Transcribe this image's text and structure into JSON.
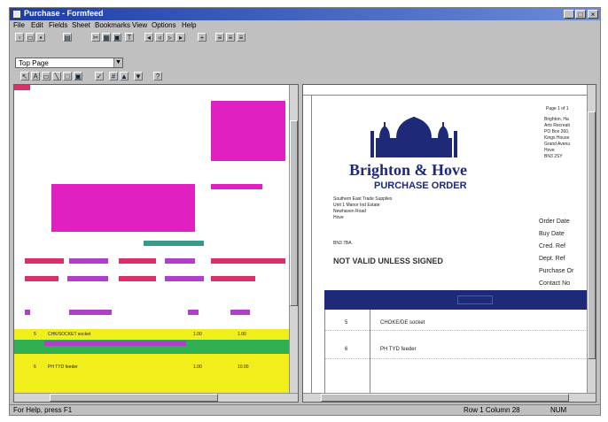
{
  "window": {
    "title": "Purchase - Formfeed"
  },
  "menu": [
    "File",
    "Edit",
    "Fields",
    "Sheet",
    "Bookmarks",
    "View",
    "Options",
    "Help"
  ],
  "style_combo": {
    "value": "Top Page"
  },
  "document": {
    "page_label": "Page 1 of 1",
    "brand": "Brighton & Hove",
    "doc_title": "PURCHASE ORDER",
    "supplier_lines": [
      "Southern East Trade Supplies",
      "Unit 1 Manor Ind Estate",
      "Newhaven Road",
      "Hove"
    ],
    "supplier_code": "BN3 7BA",
    "notice": "NOT VALID UNLESS SIGNED",
    "address_lines": [
      "Brighton, Ha",
      "Arts Recreati",
      "PO Box 260,",
      "Kings House",
      "Grand Avenu",
      "Hove",
      "BN3 2SY"
    ],
    "order_fields": [
      "Order Date",
      "Buy Date",
      "Cred. Ref",
      "Dept. Ref",
      "Purchase Or",
      "Contact No"
    ],
    "rows": [
      {
        "num": "5",
        "desc": "CHOKE/DE socket"
      },
      {
        "num": "6",
        "desc": "PH TYD feeder"
      }
    ]
  },
  "design": {
    "row1": {
      "num": "5",
      "code": "CHK/SOCKET socket",
      "a": "1.00",
      "b": "1.00"
    },
    "row2": {
      "num": "6",
      "code": "PH TYD feeder",
      "a": "1.00",
      "b": "10.00"
    }
  },
  "status": {
    "left": "For Help, press F1",
    "right1": "Row 1 Column 28",
    "right2": "NUM"
  },
  "colors": {
    "magenta": "#e020c0",
    "red": "#d8306a",
    "yellow": "#f2ee1c",
    "green": "#30b050",
    "navy": "#1e2a78"
  }
}
